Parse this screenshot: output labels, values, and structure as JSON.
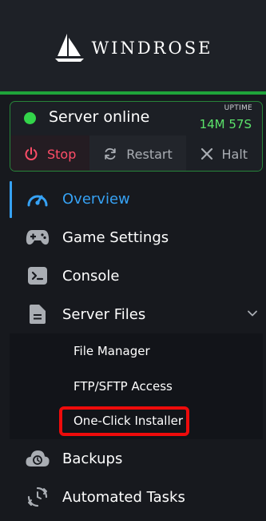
{
  "brand": {
    "name": "WINDROSE"
  },
  "status": {
    "text": "Server online",
    "uptime_label": "UPTIME",
    "uptime_value": "14M 57S",
    "indicator_color": "#33d44a"
  },
  "actions": {
    "stop": "Stop",
    "restart": "Restart",
    "halt": "Halt"
  },
  "nav": {
    "overview": "Overview",
    "game_settings": "Game Settings",
    "console": "Console",
    "server_files": "Server Files",
    "backups": "Backups",
    "automated_tasks": "Automated Tasks"
  },
  "submenu": {
    "file_manager": "File Manager",
    "ftp": "FTP/SFTP Access",
    "installer": "One-Click Installer"
  },
  "colors": {
    "accent": "#36a2f5",
    "online": "#33d44a",
    "stop": "#ff4d68",
    "highlight": "#ee0b0b"
  }
}
